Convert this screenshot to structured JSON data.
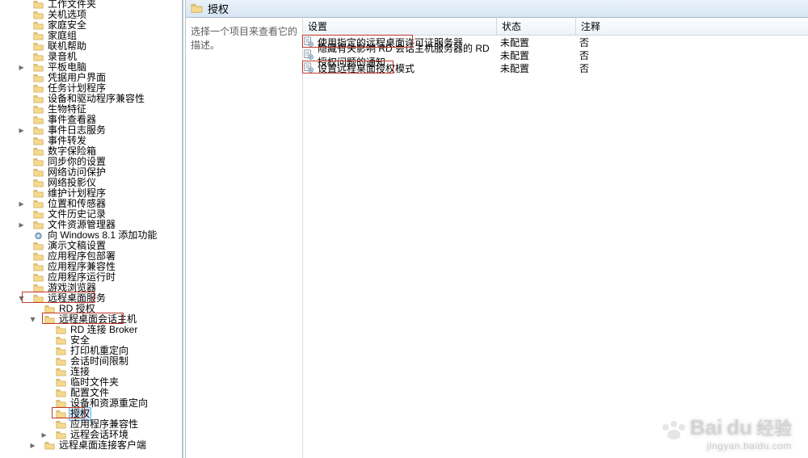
{
  "header_title": "授权",
  "description_hint": "选择一个项目来查看它的描述。",
  "columns": {
    "setting": "设置",
    "status": "状态",
    "comment": "注释"
  },
  "policies": [
    {
      "name": "使用指定的远程桌面许可证服务器",
      "status": "未配置",
      "comment": "否",
      "highlight": true
    },
    {
      "name": "隐藏有关影响 RD 会话主机服务器的 RD 授权问题的通知",
      "status": "未配置",
      "comment": "否",
      "highlight": false
    },
    {
      "name": "设置远程桌面授权模式",
      "status": "未配置",
      "comment": "否",
      "highlight": true
    }
  ],
  "tree": [
    {
      "d": 0,
      "label": "工作文件夹",
      "exp": null
    },
    {
      "d": 0,
      "label": "关机选项",
      "exp": null
    },
    {
      "d": 0,
      "label": "家庭安全",
      "exp": null
    },
    {
      "d": 0,
      "label": "家庭组",
      "exp": null
    },
    {
      "d": 0,
      "label": "联机帮助",
      "exp": null
    },
    {
      "d": 0,
      "label": "录音机",
      "exp": null
    },
    {
      "d": 0,
      "label": "平板电脑",
      "exp": "closed"
    },
    {
      "d": 0,
      "label": "凭据用户界面",
      "exp": null
    },
    {
      "d": 0,
      "label": "任务计划程序",
      "exp": null
    },
    {
      "d": 0,
      "label": "设备和驱动程序兼容性",
      "exp": null
    },
    {
      "d": 0,
      "label": "生物特征",
      "exp": null
    },
    {
      "d": 0,
      "label": "事件查看器",
      "exp": null
    },
    {
      "d": 0,
      "label": "事件日志服务",
      "exp": "closed"
    },
    {
      "d": 0,
      "label": "事件转发",
      "exp": null
    },
    {
      "d": 0,
      "label": "数字保险箱",
      "exp": null
    },
    {
      "d": 0,
      "label": "同步你的设置",
      "exp": null
    },
    {
      "d": 0,
      "label": "网络访问保护",
      "exp": null
    },
    {
      "d": 0,
      "label": "网络投影仪",
      "exp": null
    },
    {
      "d": 0,
      "label": "维护计划程序",
      "exp": null
    },
    {
      "d": 0,
      "label": "位置和传感器",
      "exp": "closed"
    },
    {
      "d": 0,
      "label": "文件历史记录",
      "exp": null
    },
    {
      "d": 0,
      "label": "文件资源管理器",
      "exp": "closed"
    },
    {
      "d": 0,
      "label": "向 Windows 8.1 添加功能",
      "exp": null,
      "icon": "gear"
    },
    {
      "d": 0,
      "label": "演示文稿设置",
      "exp": null
    },
    {
      "d": 0,
      "label": "应用程序包部署",
      "exp": null
    },
    {
      "d": 0,
      "label": "应用程序兼容性",
      "exp": null
    },
    {
      "d": 0,
      "label": "应用程序运行时",
      "exp": null
    },
    {
      "d": 0,
      "label": "游戏浏览器",
      "exp": null
    },
    {
      "d": 0,
      "label": "远程桌面服务",
      "exp": "open",
      "box": "rds"
    },
    {
      "d": 1,
      "label": "RD 授权",
      "exp": null
    },
    {
      "d": 1,
      "label": "远程桌面会话主机",
      "exp": "open",
      "box": "rdsh"
    },
    {
      "d": 2,
      "label": "RD 连接 Broker",
      "exp": null
    },
    {
      "d": 2,
      "label": "安全",
      "exp": null
    },
    {
      "d": 2,
      "label": "打印机重定向",
      "exp": null
    },
    {
      "d": 2,
      "label": "会话时间限制",
      "exp": null
    },
    {
      "d": 2,
      "label": "连接",
      "exp": null
    },
    {
      "d": 2,
      "label": "临时文件夹",
      "exp": null
    },
    {
      "d": 2,
      "label": "配置文件",
      "exp": null
    },
    {
      "d": 2,
      "label": "设备和资源重定向",
      "exp": null
    },
    {
      "d": 2,
      "label": "授权",
      "exp": null,
      "selected": true,
      "box": "lic"
    },
    {
      "d": 2,
      "label": "应用程序兼容性",
      "exp": null
    },
    {
      "d": 2,
      "label": "远程会话环境",
      "exp": "closed"
    },
    {
      "d": 1,
      "label": "远程桌面连接客户端",
      "exp": "closed"
    }
  ],
  "watermark": {
    "brand": "Bai",
    "brand2": "du",
    "cn": "经验",
    "url": "jingyan.baidu.com"
  }
}
